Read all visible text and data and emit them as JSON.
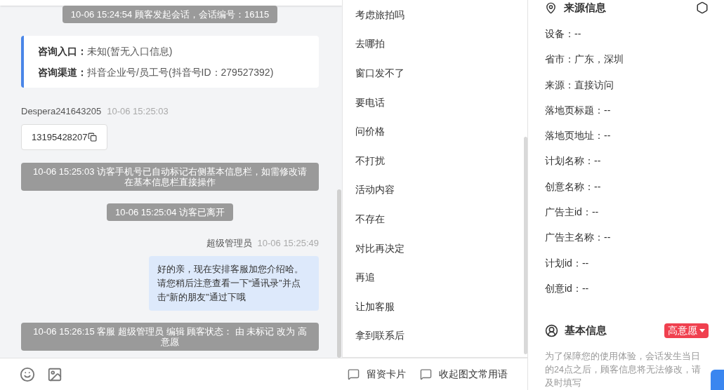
{
  "chat": {
    "messages": [
      {
        "kind": "system",
        "text": "10-06 15:24:54 顾客发起会话，会话编号：16115"
      },
      {
        "kind": "info_card",
        "rows": [
          {
            "label": "咨询入口：",
            "value": "未知(暂无入口信息)"
          },
          {
            "label": "咨询渠道：",
            "value": "抖音企业号/员工号(抖音号ID：279527392)"
          }
        ]
      },
      {
        "kind": "visitor",
        "sender": "Despera241643205",
        "time": "10-06 15:25:03",
        "text": "13195428207"
      },
      {
        "kind": "system",
        "text": "10-06 15:25:03 访客手机号已自动标记右侧基本信息栏，如需修改请在基本信息栏直接操作"
      },
      {
        "kind": "system",
        "text": "10-06 15:25:04 访客已离开"
      },
      {
        "kind": "agent",
        "sender": "超级管理员",
        "time": "10-06 15:25:49",
        "text": "好的亲，现在安排客服加您介绍哈。请您稍后注意查看一下“通讯录”并点击“新的朋友”通过下哦"
      },
      {
        "kind": "system",
        "text": "10-06 15:26:15 客服 超级管理员 编辑 顾客状态： 由 未标记 改为 高意愿"
      }
    ]
  },
  "quick_replies": [
    "考虑旅拍吗",
    "去哪拍",
    "窗口发不了",
    "要电话",
    "问价格",
    "不打扰",
    "活动内容",
    "不存在",
    "对比再决定",
    "再追",
    "让加客服",
    "拿到联系后"
  ],
  "toolbar": {
    "buttons": [
      "留资卡片",
      "收起图文常用语"
    ]
  },
  "source_info": {
    "title": "来源信息",
    "fields": [
      "设备：--",
      "省市：广东，深圳",
      "来源：直接访问",
      "落地页标题：--",
      "落地页地址：--",
      "计划名称：--",
      "创意名称：--",
      "广告主id：--",
      "广告主名称：--",
      "计划id：--",
      "创意id：--"
    ]
  },
  "basic_info": {
    "title": "基本信息",
    "status": {
      "label": "高意愿",
      "color": "#f0404f"
    },
    "note": "为了保障您的使用体验，会话发生当日的24点之后，顾客信息将无法修改，请及时填写"
  }
}
